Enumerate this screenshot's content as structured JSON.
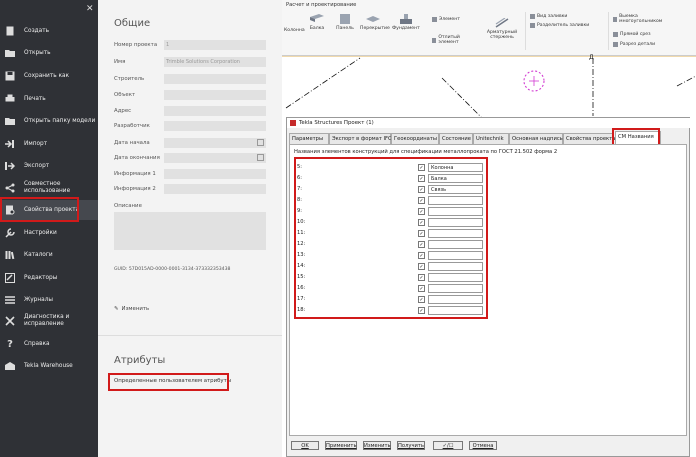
{
  "sidebar": {
    "items": [
      {
        "label": "Создать",
        "icon": "file-plus-icon"
      },
      {
        "label": "Открыть",
        "icon": "folder-icon"
      },
      {
        "label": "Сохранить как",
        "icon": "save-icon"
      },
      {
        "label": "Печать",
        "icon": "printer-icon"
      },
      {
        "label": "Открыть папку модели",
        "icon": "folder-open-icon"
      },
      {
        "label": "Импорт",
        "icon": "import-icon"
      },
      {
        "label": "Экспорт",
        "icon": "export-icon"
      },
      {
        "label": "Совместное использование",
        "icon": "share-icon"
      },
      {
        "label": "Свойства проекта",
        "icon": "project-properties-icon"
      },
      {
        "label": "Настройки",
        "icon": "wrench-icon"
      },
      {
        "label": "Каталоги",
        "icon": "books-icon"
      },
      {
        "label": "Редакторы",
        "icon": "editors-icon"
      },
      {
        "label": "Журналы",
        "icon": "list-icon"
      },
      {
        "label": "Диагностика и исправление",
        "icon": "tools-icon"
      },
      {
        "label": "Справка",
        "icon": "question-icon"
      },
      {
        "label": "Tekla Warehouse",
        "icon": "warehouse-icon"
      }
    ]
  },
  "middle": {
    "general_title": "Общие",
    "fields": [
      {
        "label": "Номер проекта",
        "value": "1"
      },
      {
        "label": "Имя",
        "value": "Trimble Solutions Corporation"
      },
      {
        "label": "Строитель",
        "value": ""
      },
      {
        "label": "Объект",
        "value": ""
      },
      {
        "label": "Адрес",
        "value": ""
      },
      {
        "label": "Разработчик",
        "value": ""
      },
      {
        "label": "Дата начала",
        "value": ""
      },
      {
        "label": "Дата окончания",
        "value": ""
      },
      {
        "label": "Информация 1",
        "value": ""
      },
      {
        "label": "Информация 2",
        "value": ""
      }
    ],
    "description_label": "Описание",
    "guid": "GUID: 57D015AD-0000-0001-3134-373332353438",
    "edit_label": "Изменить",
    "attributes_title": "Атрибуты",
    "user_attributes_link": "Определенные пользователем атрибуты"
  },
  "ribbon": {
    "tab": "Расчет и проектирование",
    "buttons": [
      "Колонна",
      "Балка",
      "Панель",
      "Перекрытие",
      "Фундамент",
      "Элемент",
      "Отлитый элемент",
      "Арматурный стержень"
    ],
    "small": [
      "Вид заливки",
      "Разделитель заливки",
      "Выемка многоугольником",
      "Прямой срез",
      "Разрез детали"
    ]
  },
  "viewport": {
    "grid_label": "Д"
  },
  "dialog": {
    "title": "Tekla Structures  Проект (1)",
    "tabs": [
      "Параметры",
      "Экспорт в формат IFC",
      "Геокоординаты",
      "Состояние",
      "Unitechnik",
      "Основная надпись",
      "Свойства проекта",
      "CM Названия"
    ],
    "description": "Названия элементов конструкций для спецификации металлопроката по ГОСТ 21.502 форма 2",
    "rows": [
      {
        "num": "5:",
        "value": "Колонна"
      },
      {
        "num": "6:",
        "value": "Балка"
      },
      {
        "num": "7:",
        "value": "Связь"
      },
      {
        "num": "8:",
        "value": ""
      },
      {
        "num": "9:",
        "value": ""
      },
      {
        "num": "10:",
        "value": ""
      },
      {
        "num": "11:",
        "value": ""
      },
      {
        "num": "12:",
        "value": ""
      },
      {
        "num": "13:",
        "value": ""
      },
      {
        "num": "14:",
        "value": ""
      },
      {
        "num": "15:",
        "value": ""
      },
      {
        "num": "16:",
        "value": ""
      },
      {
        "num": "17:",
        "value": ""
      },
      {
        "num": "18:",
        "value": ""
      }
    ],
    "check_mark": "✓",
    "toggle_label": "✓/☐",
    "footer": {
      "ok": "OK",
      "apply": "Применить",
      "modify": "Изменить",
      "get": "Получить",
      "cancel": "Отмена"
    }
  }
}
